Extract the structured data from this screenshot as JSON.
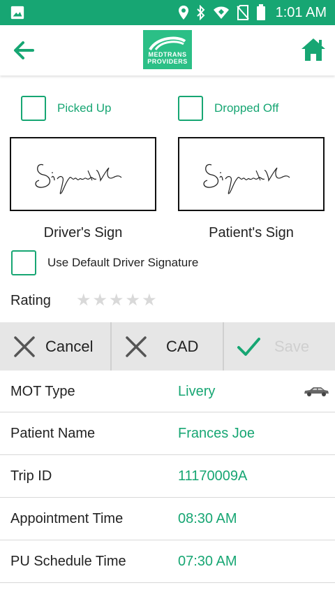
{
  "status_bar": {
    "time": "1:01 AM",
    "icons": [
      "image-icon",
      "location-icon",
      "bluetooth-icon",
      "wifi-icon",
      "no-sim-icon",
      "battery-icon"
    ]
  },
  "header": {
    "logo_line1": "MEDTRANS",
    "logo_line2": "PROVIDERS",
    "icons": [
      "back-arrow-icon",
      "home-icon"
    ]
  },
  "checkboxes": {
    "picked_up": "Picked Up",
    "dropped_off": "Dropped Off",
    "use_default": "Use Default Driver Signature"
  },
  "signatures": {
    "driver_label": "Driver's Sign",
    "patient_label": "Patient's Sign"
  },
  "rating": {
    "label": "Rating",
    "stars": 5,
    "selected": 0
  },
  "actions": {
    "cancel": "Cancel",
    "cad": "CAD",
    "save": "Save"
  },
  "trip": {
    "rows": [
      {
        "key": "MOT Type",
        "value": "Livery"
      },
      {
        "key": "Patient Name",
        "value": "Frances Joe"
      },
      {
        "key": "Trip ID",
        "value": "11170009A"
      },
      {
        "key": "Appointment Time",
        "value": "08:30 AM"
      },
      {
        "key": "PU Schedule Time",
        "value": "07:30 AM"
      }
    ]
  },
  "colors": {
    "accent": "#17a673",
    "logo_bg": "#2bbf86",
    "action_bar_bg": "#e6e6e6",
    "star_empty": "#d9d9d9"
  }
}
